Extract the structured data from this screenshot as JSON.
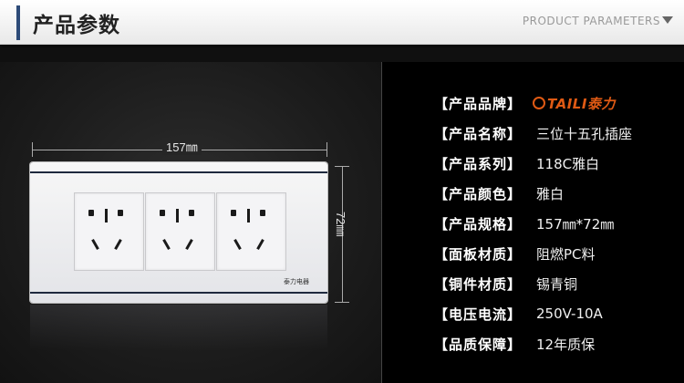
{
  "header": {
    "title": "产品参数",
    "subtitle": "PRODUCT PARAMETERS"
  },
  "product_image": {
    "width_label": "157㎜",
    "height_label": "72㎜",
    "brand_mark": "泰力电器"
  },
  "params": [
    {
      "label": "【产品品牌】",
      "value": ""
    },
    {
      "label": "【产品名称】",
      "value": "三位十五孔插座"
    },
    {
      "label": "【产品系列】",
      "value": "118C雅白"
    },
    {
      "label": "【产品颜色】",
      "value": "雅白"
    },
    {
      "label": "【产品规格】",
      "value": "157㎜*72㎜"
    },
    {
      "label": "【面板材质】",
      "value": "阻燃PC料"
    },
    {
      "label": "【铜件材质】",
      "value": "锡青铜"
    },
    {
      "label": "【电压电流】",
      "value": "250V-10A"
    },
    {
      "label": "【品质保障】",
      "value": "12年质保"
    }
  ],
  "brand_logo": {
    "text": "TAILI泰力",
    "color": "#e05a14"
  },
  "colors": {
    "accent": "#2d4b78",
    "panel_line": "#1f2a3e"
  }
}
